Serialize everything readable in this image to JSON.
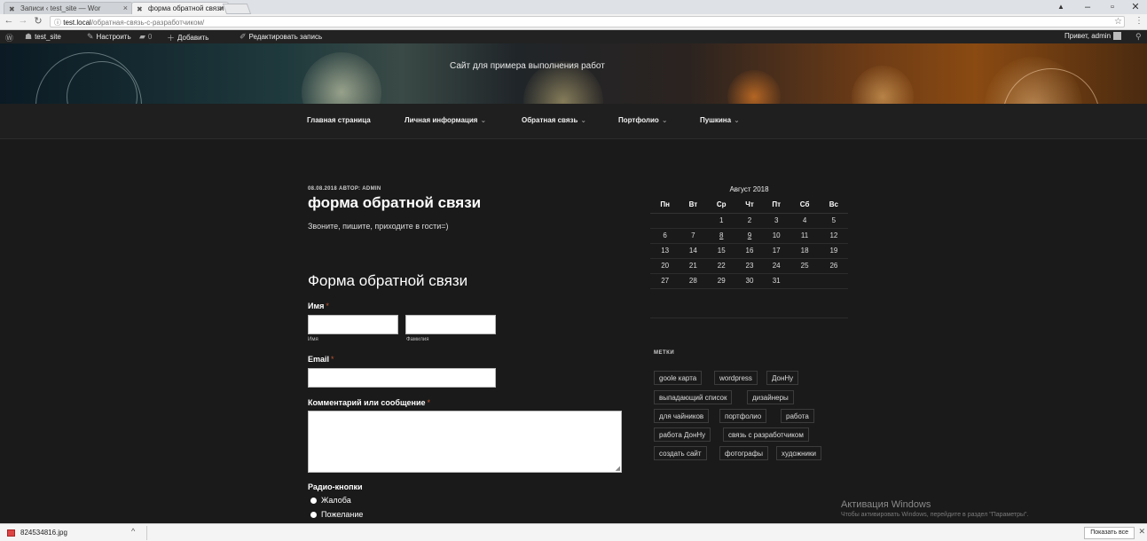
{
  "browser": {
    "tabs": [
      {
        "label": "Записи ‹ test_site — Wor"
      },
      {
        "label": "форма обратной связи"
      }
    ],
    "url_host": "test.local",
    "url_path": "/обратная-связь-с-разработчиком/",
    "window_controls": [
      "–",
      "▫",
      "✕"
    ]
  },
  "adminbar": {
    "site": "test_site",
    "customize": "Настроить",
    "comments": "0",
    "add": "Добавить",
    "edit": "Редактировать запись",
    "greeting": "Привет, admin"
  },
  "header": {
    "description": "Сайт для примера выполнения работ"
  },
  "nav": {
    "items": [
      {
        "label": "Главная страница",
        "chevron": ""
      },
      {
        "label": "Личная информация",
        "chevron": "⌄"
      },
      {
        "label": "Обратная связь",
        "chevron": "⌄"
      },
      {
        "label": "Портфолио",
        "chevron": "⌄"
      },
      {
        "label": "Пушкина",
        "chevron": "⌄"
      }
    ]
  },
  "post": {
    "meta": "08.08.2018 АВТОР: ADMIN",
    "title": "форма обратной связи",
    "text": "Звоните, пишите, приходите в гости=)"
  },
  "form": {
    "title": "Форма обратной связи",
    "name_label": "Имя",
    "first_sub": "Имя",
    "last_sub": "Фамилия",
    "email_label": "Email",
    "comment_label": "Комментарий или сообщение",
    "required_mark": "*",
    "radio_label": "Радио-кнопки",
    "radio_options": [
      "Жалоба",
      "Пожелание"
    ]
  },
  "calendar": {
    "caption": "Август 2018",
    "weekdays": [
      "Пн",
      "Вт",
      "Ср",
      "Чт",
      "Пт",
      "Сб",
      "Вс"
    ],
    "weeks": [
      [
        "",
        "",
        "1",
        "2",
        "3",
        "4",
        "5"
      ],
      [
        "6",
        "7",
        "8",
        "9",
        "10",
        "11",
        "12"
      ],
      [
        "13",
        "14",
        "15",
        "16",
        "17",
        "18",
        "19"
      ],
      [
        "20",
        "21",
        "22",
        "23",
        "24",
        "25",
        "26"
      ],
      [
        "27",
        "28",
        "29",
        "30",
        "31",
        "",
        ""
      ]
    ],
    "linked_days": [
      "8",
      "9"
    ]
  },
  "tags": {
    "title": "МЕТКИ",
    "rows": [
      [
        "goole карта",
        "wordpress",
        "ДонНу"
      ],
      [
        "выпадающий список",
        "дизайнеры"
      ],
      [
        "для чайников",
        "портфолио",
        "работа"
      ],
      [
        "работа ДонНу",
        "связь с разработчиком"
      ],
      [
        "создать сайт",
        "фотографы",
        "художники"
      ]
    ]
  },
  "watermark": {
    "line1": "Активация Windows",
    "line2": "Чтобы активировать Windows, перейдите в раздел \"Параметры\"."
  },
  "downloads": {
    "file": "824534816.jpg",
    "show_all": "Показать все"
  }
}
